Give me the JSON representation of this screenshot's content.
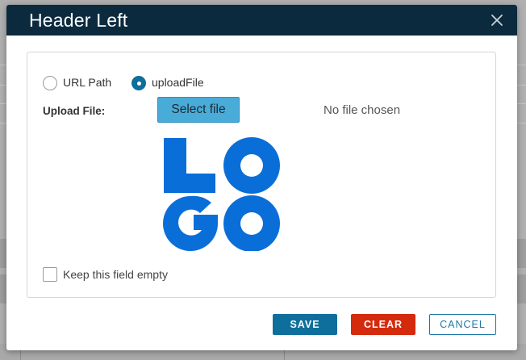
{
  "modal": {
    "title": "Header Left",
    "close_icon": "close-icon"
  },
  "source": {
    "options": [
      {
        "label": "URL Path",
        "checked": false
      },
      {
        "label": "uploadFile",
        "checked": true
      }
    ]
  },
  "upload": {
    "label": "Upload File:",
    "button_label": "Select file",
    "status": "No file chosen"
  },
  "preview": {
    "logo_text": "LOGO"
  },
  "keep_empty": {
    "label": "Keep this field empty",
    "checked": false
  },
  "actions": {
    "save": "SAVE",
    "clear": "CLEAR",
    "cancel": "CANCEL"
  },
  "colors": {
    "header": "#0c2a3e",
    "primary": "#0f6f9c",
    "danger": "#d42a0e",
    "select_button": "#49abd8",
    "logo": "#0a6ed8"
  }
}
